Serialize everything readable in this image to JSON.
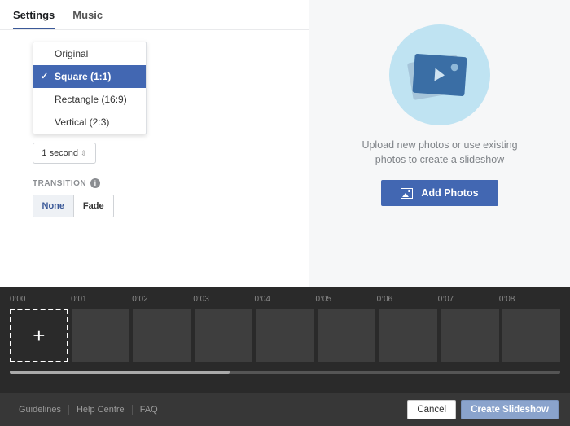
{
  "tabs": {
    "settings": "Settings",
    "music": "Music"
  },
  "aspect_dropdown": {
    "options": [
      "Original",
      "Square (1:1)",
      "Rectangle (16:9)",
      "Vertical (2:3)"
    ],
    "selected_index": 1
  },
  "duration_value": "1 second",
  "transition": {
    "label": "TRANSITION",
    "none": "None",
    "fade": "Fade"
  },
  "upload_hint": "Upload new photos or use existing photos to create a slideshow",
  "add_photos_label": "Add Photos",
  "timeline": {
    "ticks": [
      "0:00",
      "0:01",
      "0:02",
      "0:03",
      "0:04",
      "0:05",
      "0:06",
      "0:07",
      "0:08"
    ]
  },
  "footer": {
    "guidelines": "Guidelines",
    "help": "Help Centre",
    "faq": "FAQ",
    "cancel": "Cancel",
    "create": "Create Slideshow"
  }
}
